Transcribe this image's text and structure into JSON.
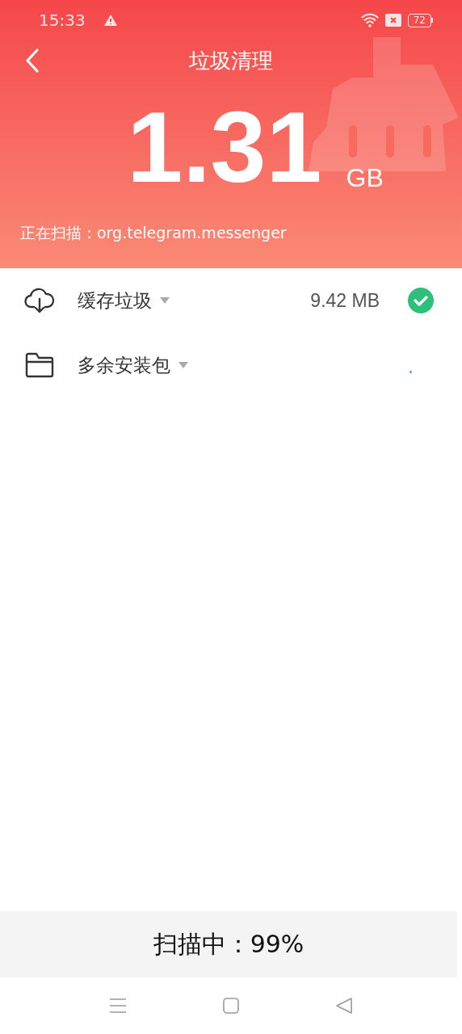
{
  "status_bar": {
    "time": "15:33",
    "battery": "72"
  },
  "header": {
    "title": "垃圾清理",
    "size_value": "1.31",
    "size_unit": "GB",
    "scanning": "正在扫描：org.telegram.messenger"
  },
  "categories": [
    {
      "label": "缓存垃圾",
      "size": "9.42 MB",
      "kind": "done"
    },
    {
      "label": "多余安装包",
      "kind": "scanning"
    }
  ],
  "footer": {
    "progress": "扫描中：99%"
  }
}
